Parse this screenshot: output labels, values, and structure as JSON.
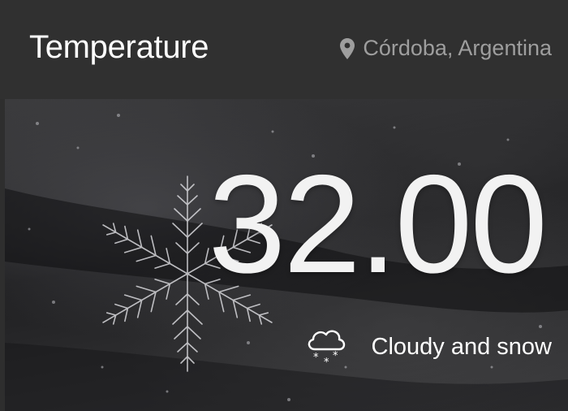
{
  "header": {
    "title": "Temperature",
    "location": "Córdoba, Argentina",
    "location_icon": "map-pin-icon"
  },
  "weather": {
    "temperature": "32.00",
    "condition": "Cloudy and snow",
    "condition_icon": "cloud-snow-icon"
  },
  "colors": {
    "header_bg": "#303030",
    "title": "#ffffff",
    "location_text": "#9e9e9e",
    "temperature_text": "#f2f2f2"
  }
}
